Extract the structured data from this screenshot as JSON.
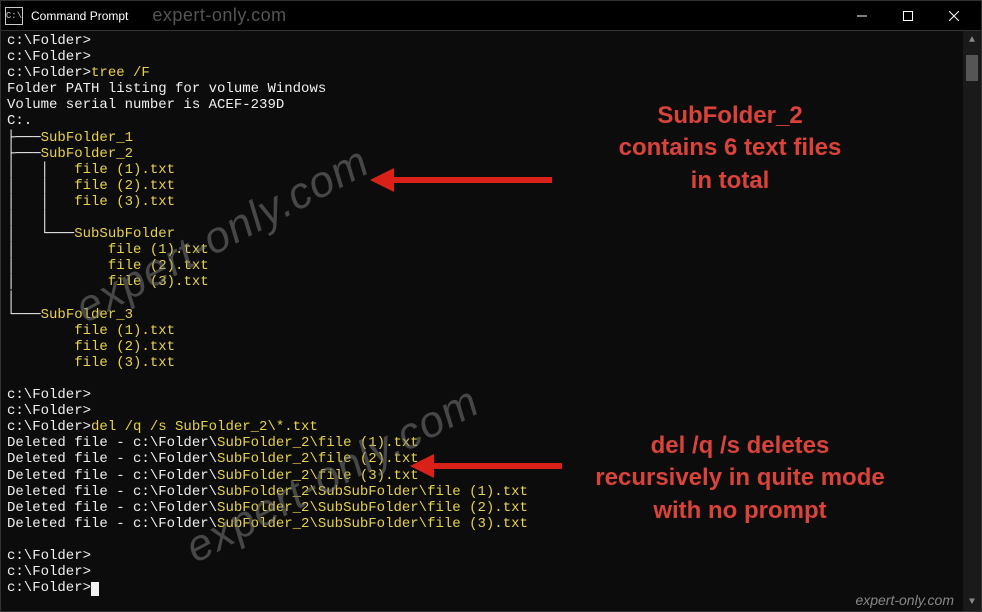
{
  "window": {
    "title": "Command Prompt",
    "titlebar_watermark": "expert-only.com"
  },
  "terminal": {
    "prompts": {
      "path": "c:\\Folder>",
      "tree_cmd": "tree /F",
      "del_cmd": "del /q /s SubFolder_2\\*.txt"
    },
    "tree": {
      "header1": "Folder PATH listing for volume Windows",
      "header2": "Volume serial number is ACEF-239D",
      "root": "C:.",
      "sub1": "SubFolder_1",
      "sub2": "SubFolder_2",
      "sub2_files": [
        "file (1).txt",
        "file (2).txt",
        "file (3).txt"
      ],
      "subsub": "SubSubFolder",
      "subsub_files": [
        "file (1).txt",
        "file (2).txt",
        "file (3).txt"
      ],
      "sub3": "SubFolder_3",
      "sub3_files": [
        "file (1).txt",
        "file (2).txt",
        "file (3).txt"
      ]
    },
    "deleted": {
      "prefix": "Deleted file - c:\\Folder\\",
      "lines": [
        "SubFolder_2\\file (1).txt",
        "SubFolder_2\\file (2).txt",
        "SubFolder_2\\file (3).txt",
        "SubFolder_2\\SubSubFolder\\file (1).txt",
        "SubFolder_2\\SubSubFolder\\file (2).txt",
        "SubFolder_2\\SubSubFolder\\file (3).txt"
      ]
    }
  },
  "annotations": {
    "a1": "SubFolder_2\ncontains 6 text files\nin total",
    "a2": "del /q /s deletes\nrecursively in quite mode\nwith no prompt"
  },
  "watermark": "expert-only.com"
}
